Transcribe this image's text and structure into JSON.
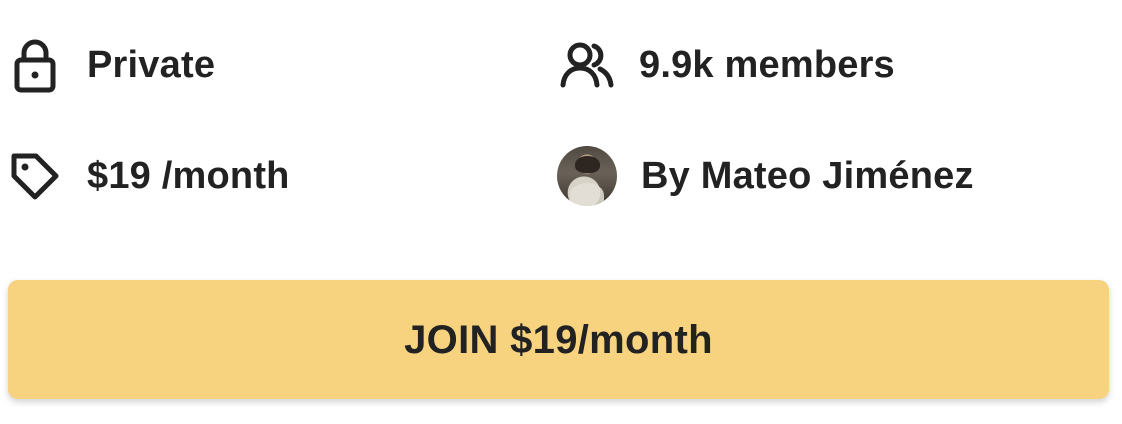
{
  "group_info": {
    "privacy": {
      "icon": "lock-icon",
      "label": "Private"
    },
    "members": {
      "icon": "users-icon",
      "label": "9.9k members"
    },
    "price": {
      "icon": "tag-icon",
      "label": "$19 /month"
    },
    "owner": {
      "icon": "avatar",
      "label": "By Mateo Jiménez"
    }
  },
  "join_button": {
    "label": "JOIN $19/month",
    "background": "#f7d37f",
    "text_color": "#222222"
  }
}
